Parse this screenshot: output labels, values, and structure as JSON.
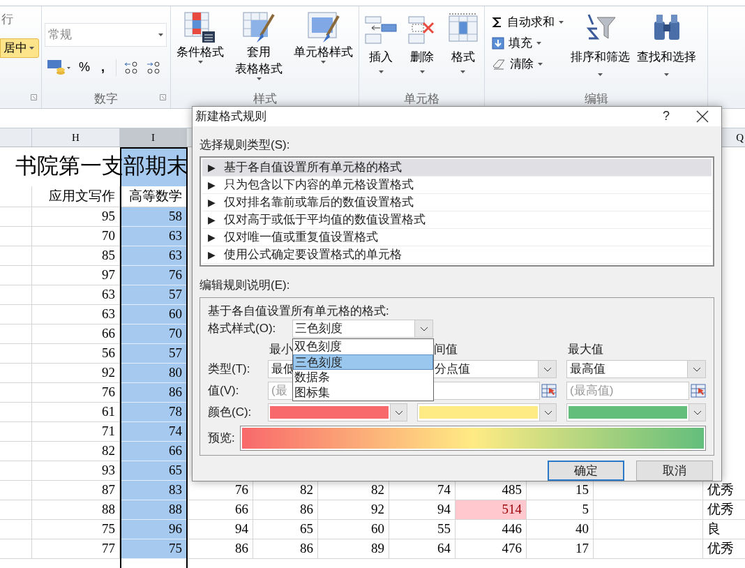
{
  "ribbon": {
    "alignment": {
      "wrap_label": "行",
      "merge_label": "居中"
    },
    "number": {
      "format": "常规",
      "symbols": [
        "%",
        ","
      ],
      "label": "数字"
    },
    "styles": {
      "buttons": [
        {
          "lines": [
            "条件格式"
          ]
        },
        {
          "lines": [
            "套用",
            "表格格式"
          ]
        },
        {
          "lines": [
            "单元格样式"
          ]
        }
      ],
      "label": "样式"
    },
    "cells": {
      "buttons": [
        {
          "label": "插入"
        },
        {
          "label": "删除"
        },
        {
          "label": "格式"
        }
      ],
      "label": "单元格"
    },
    "editing": {
      "small": [
        {
          "label": "自动求和"
        },
        {
          "label": "填充"
        },
        {
          "label": "清除"
        }
      ],
      "large": [
        {
          "label": "排序和筛选"
        },
        {
          "label": "查找和选择"
        }
      ],
      "label": "编辑"
    }
  },
  "sheet": {
    "columns": [
      {
        "letter": "H",
        "selected": false
      },
      {
        "letter": "I",
        "selected": true
      },
      {
        "letter": "Q",
        "selected": false
      }
    ],
    "title": "书院第一支部期末",
    "headers": [
      "应用文写作",
      "高等数学"
    ],
    "rows": [
      {
        "h": "95",
        "i": "58"
      },
      {
        "h": "70",
        "i": "63"
      },
      {
        "h": "85",
        "i": "63"
      },
      {
        "h": "97",
        "i": "76"
      },
      {
        "h": "63",
        "i": "57"
      },
      {
        "h": "63",
        "i": "60"
      },
      {
        "h": "66",
        "i": "70"
      },
      {
        "h": "56",
        "i": "57"
      },
      {
        "h": "92",
        "i": "80"
      },
      {
        "h": "76",
        "i": "86"
      },
      {
        "h": "61",
        "i": "78"
      },
      {
        "h": "71",
        "i": "74"
      },
      {
        "h": "82",
        "i": "66"
      },
      {
        "h": "93",
        "i": "65"
      },
      {
        "h": "87",
        "i": "83",
        "rest": [
          "76",
          "82",
          "82",
          "74",
          "485",
          "15"
        ],
        "n_highlighted": false,
        "q": "优秀"
      },
      {
        "h": "88",
        "i": "88",
        "rest": [
          "66",
          "86",
          "92",
          "94",
          "514",
          "5"
        ],
        "n_highlighted": true,
        "q": "优秀"
      },
      {
        "h": "75",
        "i": "96",
        "rest": [
          "94",
          "65",
          "60",
          "55",
          "446",
          "40"
        ],
        "n_highlighted": false,
        "q": "良"
      },
      {
        "h": "77",
        "i": "75",
        "rest": [
          "86",
          "86",
          "89",
          "64",
          "476",
          "17"
        ],
        "n_highlighted": false,
        "q": "优秀"
      }
    ]
  },
  "dialog": {
    "title": "新建格式规则",
    "help": "?",
    "rule_type_label": "选择规则类型(S):",
    "rule_types": [
      {
        "label": "基于各自值设置所有单元格的格式",
        "selected": true
      },
      {
        "label": "只为包含以下内容的单元格设置格式",
        "selected": false
      },
      {
        "label": "仅对排名靠前或靠后的数值设置格式",
        "selected": false
      },
      {
        "label": "仅对高于或低于平均值的数值设置格式",
        "selected": false
      },
      {
        "label": "仅对唯一值或重复值设置格式",
        "selected": false
      },
      {
        "label": "使用公式确定要设置格式的单元格",
        "selected": false
      }
    ],
    "marker": "▶",
    "edit_label": "编辑规则说明(E):",
    "description": "基于各自值设置所有单元格的格式:",
    "format_style_label": "格式样式(O):",
    "format_style_value": "三色刻度",
    "format_options": [
      {
        "label": "双色刻度",
        "selected": false
      },
      {
        "label": "三色刻度",
        "selected": true
      },
      {
        "label": "数据条",
        "selected": false
      },
      {
        "label": "图标集",
        "selected": false
      }
    ],
    "column_headers": [
      "最小",
      "间值",
      "最大值"
    ],
    "type_label": "类型(T):",
    "types": [
      "最低",
      "分点值",
      "最高值"
    ],
    "value_label": "值(V):",
    "value_fields": [
      {
        "placeholder": "(最",
        "range_button": false
      },
      {
        "range_button": true
      },
      {
        "placeholder": "(最高值)",
        "range_button": true
      }
    ],
    "color_label": "颜色(C):",
    "colors": [
      {
        "color": "#f8696b"
      },
      {
        "color": "#ffeb84"
      },
      {
        "color": "#63be7b"
      }
    ],
    "preview_label": "预览:",
    "buttons": [
      {
        "label": "确定",
        "default": true
      },
      {
        "label": "取消",
        "default": false
      }
    ]
  }
}
